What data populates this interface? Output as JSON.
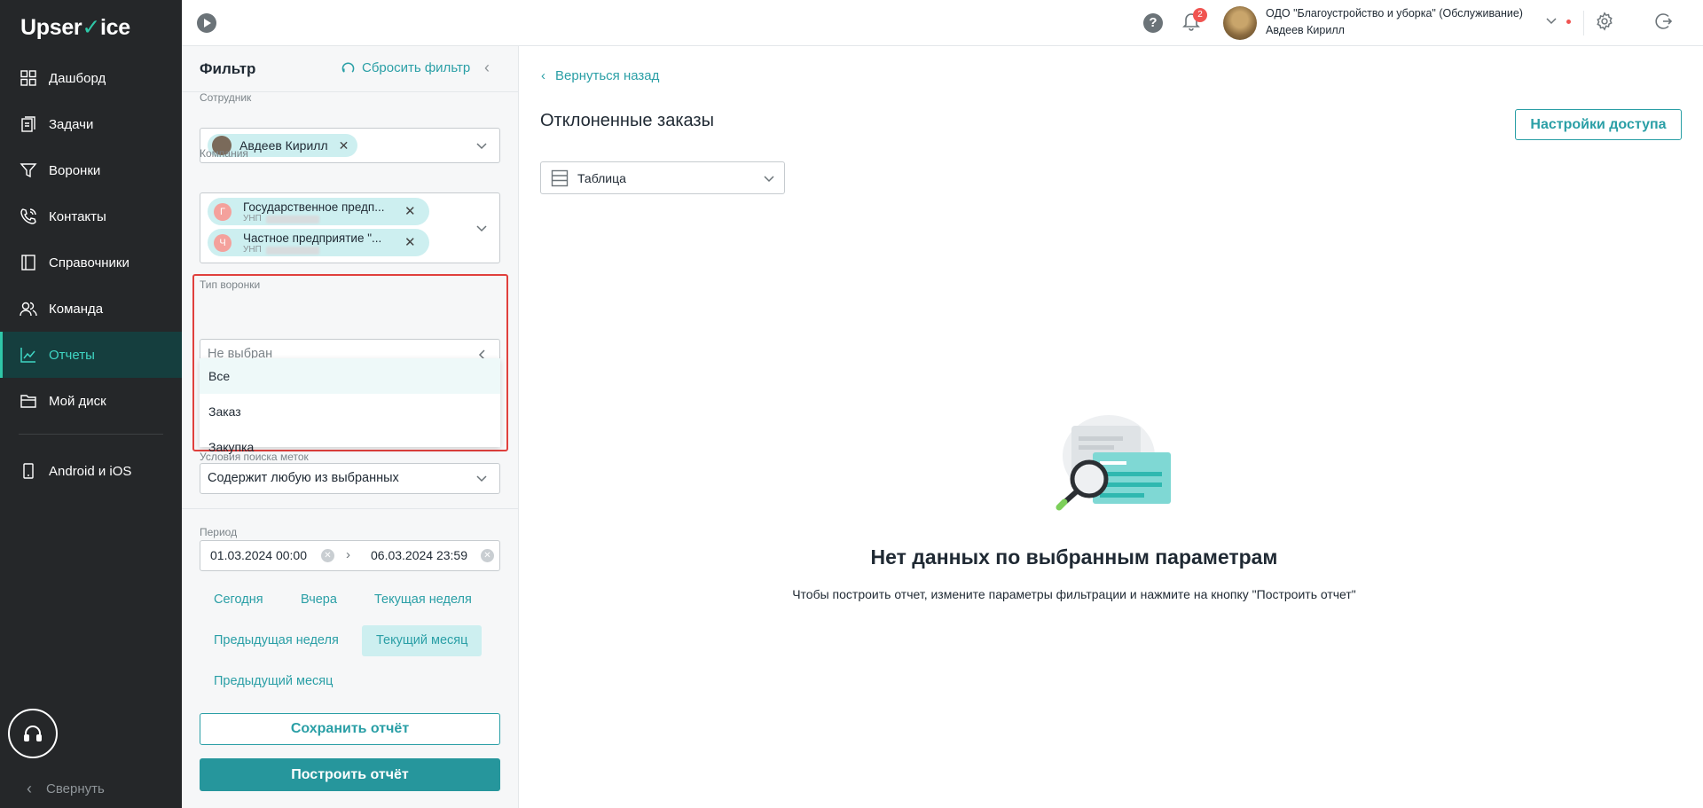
{
  "app": {
    "logo_prefix": "Upser",
    "logo_check": "✓",
    "logo_suffix": "ice"
  },
  "sidebar": {
    "items": [
      {
        "label": "Дашборд",
        "icon": "dashboard-icon"
      },
      {
        "label": "Задачи",
        "icon": "tasks-icon"
      },
      {
        "label": "Воронки",
        "icon": "funnel-icon"
      },
      {
        "label": "Контакты",
        "icon": "phone-icon"
      },
      {
        "label": "Справочники",
        "icon": "book-icon"
      },
      {
        "label": "Команда",
        "icon": "team-icon"
      },
      {
        "label": "Отчеты",
        "icon": "chart-icon"
      },
      {
        "label": "Мой диск",
        "icon": "folder-icon"
      },
      {
        "label": "Android и iOS",
        "icon": "mobile-icon"
      }
    ],
    "active_index": 6,
    "collapse_label": "Свернуть",
    "accent": "#2fc7a8"
  },
  "topbar": {
    "notifications_count": "2",
    "company": "ОДО \"Благоустройство и уборка\" (Обслуживание)",
    "user": "Авдеев Кирилл"
  },
  "filter": {
    "title": "Фильтр",
    "reset_label": "Сбросить фильтр",
    "employee": {
      "label": "Сотрудник",
      "chip": "Авдеев Кирилл"
    },
    "company": {
      "label": "Компания",
      "chips": [
        {
          "letter": "Г",
          "name": "Государственное предп...",
          "unp_label": "УНП"
        },
        {
          "letter": "Ч",
          "name": "Частное предприятие \"...",
          "unp_label": "УНП"
        }
      ]
    },
    "funnel_type": {
      "label": "Тип воронки",
      "placeholder": "Не выбран",
      "options": [
        "Все",
        "Заказ",
        "Закупка"
      ]
    },
    "tag_conditions": {
      "label": "Условия поиска меток",
      "value": "Содержит любую из выбранных"
    },
    "period": {
      "label": "Период",
      "from": "01.03.2024 00:00",
      "to": "06.03.2024 23:59",
      "presets": [
        "Сегодня",
        "Вчера",
        "Текущая неделя",
        "Предыдущая неделя",
        "Текущий месяц",
        "Предыдущий месяц"
      ],
      "selected": "Текущий месяц"
    },
    "save_label": "Сохранить отчёт",
    "build_label": "Построить отчёт"
  },
  "main": {
    "back_label": "Вернуться назад",
    "title": "Отклоненные заказы",
    "access_label": "Настройки доступа",
    "view_select": "Таблица",
    "empty_title": "Нет данных по выбранным параметрам",
    "empty_sub": "Чтобы построить отчет, измените параметры фильтрации и нажмите на кнопку \"Построить отчет\""
  }
}
